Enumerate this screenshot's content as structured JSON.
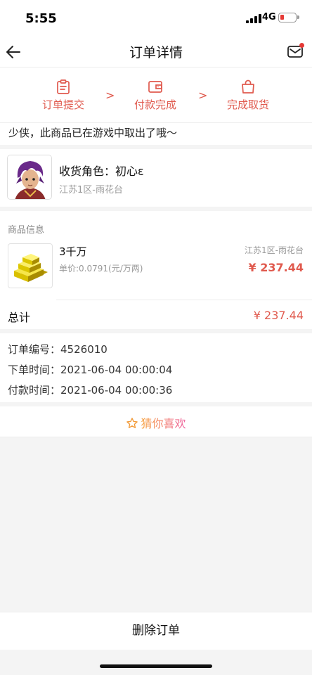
{
  "status": {
    "time": "5:55",
    "network": "4G"
  },
  "nav": {
    "title": "订单详情"
  },
  "steps": [
    {
      "label": "订单提交",
      "icon": "clipboard-icon"
    },
    {
      "label": "付款完成",
      "icon": "wallet-icon"
    },
    {
      "label": "完成取货",
      "icon": "shopping-bag-icon"
    }
  ],
  "notice": "少侠，此商品已在游戏中取出了哦～",
  "receiver": {
    "role_label": "收货角色：",
    "role_name": "初心ε",
    "server": "江苏1区-雨花台"
  },
  "goods": {
    "section_title": "商品信息",
    "name": "3千万",
    "unit_price": "单价:0.0791(元/万两)",
    "server": "江苏1区-雨花台",
    "price": "¥ 237.44",
    "total_label": "总计",
    "total_value": "¥ 237.44"
  },
  "order": {
    "number_label": "订单编号：",
    "number": "4526010",
    "created_label": "下单时间：",
    "created": "2021-06-04 00:00:04",
    "paid_label": "付款时间：",
    "paid": "2021-06-04 00:00:36"
  },
  "guess": {
    "label": "猜你喜欢"
  },
  "actions": {
    "delete_label": "删除订单"
  },
  "colors": {
    "accent": "#e05a4e",
    "guess_start": "#f7a23a",
    "guess_end": "#ee5fa0"
  }
}
